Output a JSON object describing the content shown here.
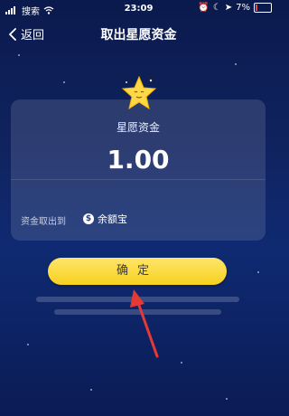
{
  "status": {
    "carrier": "搜索",
    "time": "23:09",
    "battery": "7%"
  },
  "nav": {
    "back_label": "返回",
    "title": "取出星愿资金"
  },
  "card": {
    "label": "星愿资金",
    "amount": "1.00",
    "destination_label": "资金取出到",
    "destination": "余额宝"
  },
  "confirm_label": "确定",
  "colors": {
    "background": "#0f2a72",
    "button": "#f6d21e",
    "arrow": "#e53935"
  },
  "icons": {
    "signal": "signal-icon",
    "wifi": "wifi-icon",
    "back": "chevron-left-icon",
    "star": "star-mascot-icon",
    "coin": "yuebao-coin-icon",
    "arrow": "red-annotation-arrow-icon"
  }
}
